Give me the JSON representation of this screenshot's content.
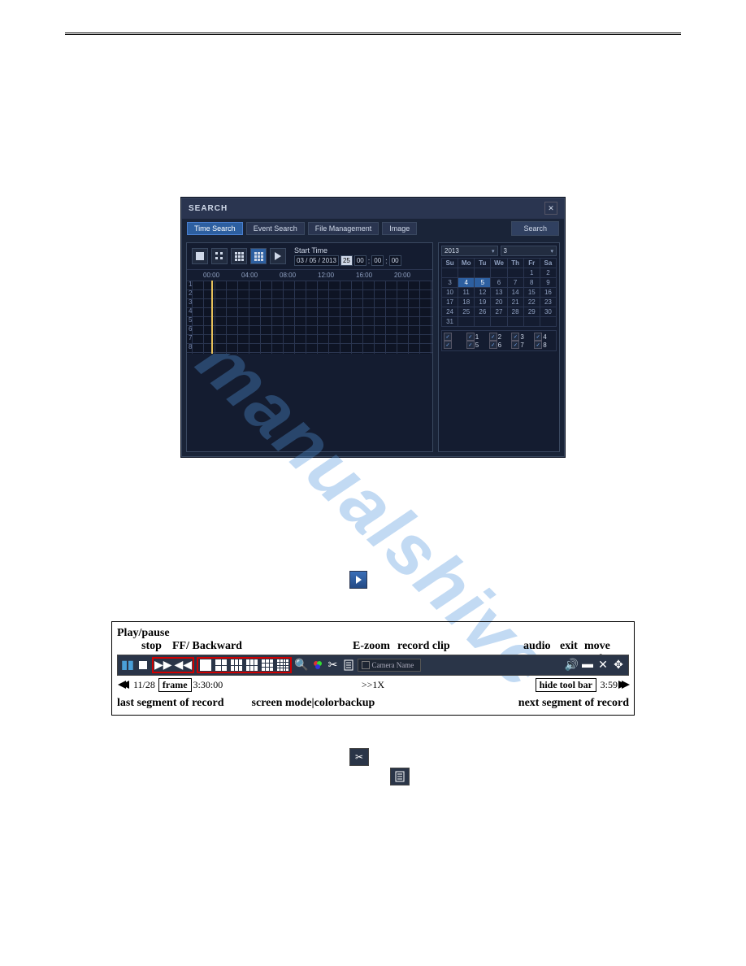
{
  "watermark_text": "manualshive",
  "search_window": {
    "title": "SEARCH",
    "tabs": [
      "Time Search",
      "Event Search",
      "File Management",
      "Image"
    ],
    "active_tab": 0,
    "search_button": "Search",
    "start_time_label": "Start Time",
    "date_value": "03 / 05 / 2013",
    "day_highlight": "25",
    "time_value": [
      "00",
      "00",
      "00"
    ],
    "timeline_hours": [
      "00:00",
      "04:00",
      "08:00",
      "12:00",
      "16:00",
      "20:00"
    ],
    "timeline_rows": [
      "1",
      "2",
      "3",
      "4",
      "5",
      "6",
      "7",
      "8"
    ],
    "calendar": {
      "year": "2013",
      "month": "3",
      "days": [
        "Su",
        "Mo",
        "Tu",
        "We",
        "Th",
        "Fr",
        "Sa"
      ],
      "cells": [
        [
          "",
          "",
          "",
          "",
          "",
          "1",
          "2"
        ],
        [
          "3",
          "4",
          "5",
          "6",
          "7",
          "8",
          "9"
        ],
        [
          "10",
          "11",
          "12",
          "13",
          "14",
          "15",
          "16"
        ],
        [
          "17",
          "18",
          "19",
          "20",
          "21",
          "22",
          "23"
        ],
        [
          "24",
          "25",
          "26",
          "27",
          "28",
          "29",
          "30"
        ],
        [
          "31",
          "",
          "",
          "",
          "",
          "",
          ""
        ]
      ],
      "selected": [
        "4",
        "5"
      ]
    },
    "channels": [
      "1",
      "2",
      "3",
      "4",
      "5",
      "6",
      "7",
      "8"
    ]
  },
  "toolbar": {
    "labels_top": {
      "play_pause": "Play/pause",
      "stop": "stop",
      "ff_backward": "FF/ Backward",
      "ezoom": "E-zoom",
      "record_clip": "record clip",
      "audio": "audio",
      "exit": "exit",
      "move_tool": "move tool"
    },
    "camera_name": "Camera Name",
    "under": {
      "date": "11/28",
      "frame": "frame",
      "time": "3:30:00",
      "speed": ">>1X",
      "hide": "hide tool bar",
      "end": "3:59"
    },
    "labels_bottom": {
      "last_segment": "last segment of record",
      "screen_mode": "screen mode",
      "color": "color",
      "backup": "backup",
      "next_segment": "next segment of record"
    }
  }
}
